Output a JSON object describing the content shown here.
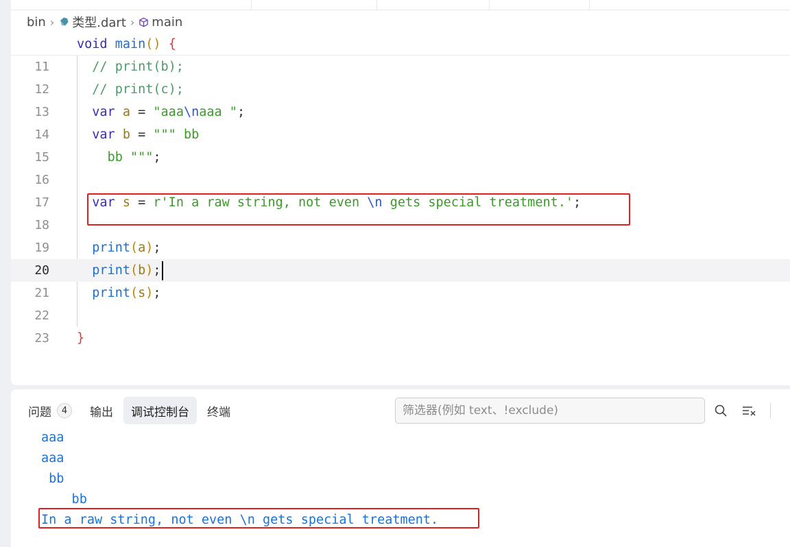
{
  "breadcrumb": {
    "folder": "bin",
    "file": "类型.dart",
    "symbol": "main"
  },
  "sticky_scroll": "void main() {",
  "code_lines": [
    {
      "num": "11",
      "text": "// print(b);"
    },
    {
      "num": "12",
      "text": "// print(c);"
    },
    {
      "num": "13",
      "text": "var a = \"aaa\\naaa \";"
    },
    {
      "num": "14",
      "text": "var b = \"\"\" bb"
    },
    {
      "num": "15",
      "text": "  bb \"\"\";"
    },
    {
      "num": "16",
      "text": ""
    },
    {
      "num": "17",
      "text": "var s = r'In a raw string, not even \\n gets special treatment.';"
    },
    {
      "num": "18",
      "text": ""
    },
    {
      "num": "19",
      "text": "print(a);"
    },
    {
      "num": "20",
      "text": "print(b);"
    },
    {
      "num": "21",
      "text": "print(s);"
    },
    {
      "num": "22",
      "text": ""
    },
    {
      "num": "23",
      "text": "}"
    }
  ],
  "panel": {
    "tabs": {
      "problems": "问题",
      "problems_count": "4",
      "output": "输出",
      "debug_console": "调试控制台",
      "terminal": "终端"
    },
    "filter_placeholder": "筛选器(例如 text、!exclude)"
  },
  "console_output": [
    "aaa",
    "aaa",
    " bb",
    "    bb",
    "In a raw string, not even \\n gets special treatment."
  ],
  "colors": {
    "highlight_box": "#e02020",
    "console_text": "#1a73d9"
  },
  "icons": [
    "dart-file-icon",
    "symbol-method-icon",
    "search-icon",
    "clear-console-icon"
  ]
}
